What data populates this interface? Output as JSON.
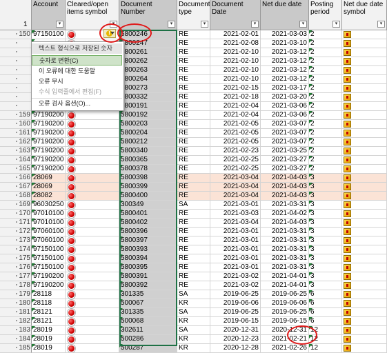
{
  "header": {
    "row_number": "1",
    "columns": [
      {
        "key": "account",
        "label": "Account"
      },
      {
        "key": "cleared",
        "label": "Cleared/open items symbol"
      },
      {
        "key": "docnum",
        "label": "Document Number"
      },
      {
        "key": "doctype",
        "label": "Document type"
      },
      {
        "key": "docdate",
        "label": "Document Date"
      },
      {
        "key": "netdue",
        "label": "Net due date"
      },
      {
        "key": "period",
        "label": "Posting period"
      },
      {
        "key": "netsym",
        "label": "Net due date symbol"
      }
    ],
    "filter_glyph": "▾"
  },
  "context_menu": {
    "items": [
      {
        "label": "텍스트 형식으로 저장된 숫자",
        "state": "title"
      },
      {
        "label": "숫자로 변환(C)",
        "state": "active"
      },
      {
        "label": "이 오류에 대한 도움말",
        "state": "normal"
      },
      {
        "label": "오류 무시",
        "state": "normal"
      },
      {
        "label": "수식 입력줄에서 편집(F)",
        "state": "disabled"
      },
      {
        "label": "오류 검사 옵션(O)...",
        "state": "normal"
      }
    ]
  },
  "warning_button": {
    "glyph": "!"
  },
  "rows": [
    {
      "n": "150",
      "account": "97150100",
      "doc": "5800246",
      "type": "RE",
      "date": "2021-02-01",
      "due": "2021-03-03",
      "period": "2",
      "hl": false
    },
    {
      "n": "",
      "account": "",
      "doc": "5800247",
      "type": "RE",
      "date": "2021-02-08",
      "due": "2021-03-10",
      "period": "2",
      "hl": false
    },
    {
      "n": "",
      "account": "",
      "doc": "5800261",
      "type": "RE",
      "date": "2021-02-10",
      "due": "2021-03-12",
      "period": "2",
      "hl": false
    },
    {
      "n": "",
      "account": "",
      "doc": "5800262",
      "type": "RE",
      "date": "2021-02-10",
      "due": "2021-03-12",
      "period": "2",
      "hl": false
    },
    {
      "n": "",
      "account": "",
      "doc": "5800263",
      "type": "RE",
      "date": "2021-02-10",
      "due": "2021-03-12",
      "period": "2",
      "hl": false
    },
    {
      "n": "",
      "account": "",
      "doc": "5800264",
      "type": "RE",
      "date": "2021-02-10",
      "due": "2021-03-12",
      "period": "2",
      "hl": false
    },
    {
      "n": "",
      "account": "",
      "doc": "5800273",
      "type": "RE",
      "date": "2021-02-15",
      "due": "2021-03-17",
      "period": "2",
      "hl": false
    },
    {
      "n": "",
      "account": "",
      "doc": "5800332",
      "type": "RE",
      "date": "2021-02-18",
      "due": "2021-03-20",
      "period": "2",
      "hl": false
    },
    {
      "n": "",
      "account": "",
      "doc": "5800191",
      "type": "RE",
      "date": "2021-02-04",
      "due": "2021-03-06",
      "period": "2",
      "hl": false
    },
    {
      "n": "159",
      "account": "97190200",
      "doc": "5800192",
      "type": "RE",
      "date": "2021-02-04",
      "due": "2021-03-06",
      "period": "2",
      "hl": false
    },
    {
      "n": "160",
      "account": "97190200",
      "doc": "5800203",
      "type": "RE",
      "date": "2021-02-05",
      "due": "2021-03-07",
      "period": "2",
      "hl": false
    },
    {
      "n": "161",
      "account": "97190200",
      "doc": "5800204",
      "type": "RE",
      "date": "2021-02-05",
      "due": "2021-03-07",
      "period": "2",
      "hl": false
    },
    {
      "n": "162",
      "account": "97190200",
      "doc": "5800212",
      "type": "RE",
      "date": "2021-02-05",
      "due": "2021-03-07",
      "period": "2",
      "hl": false
    },
    {
      "n": "163",
      "account": "97190200",
      "doc": "5800340",
      "type": "RE",
      "date": "2021-02-23",
      "due": "2021-03-25",
      "period": "2",
      "hl": false
    },
    {
      "n": "164",
      "account": "97190200",
      "doc": "5800365",
      "type": "RE",
      "date": "2021-02-25",
      "due": "2021-03-27",
      "period": "2",
      "hl": false
    },
    {
      "n": "165",
      "account": "97190200",
      "doc": "5800378",
      "type": "RE",
      "date": "2021-02-25",
      "due": "2021-03-27",
      "period": "2",
      "hl": false
    },
    {
      "n": "166",
      "account": "28069",
      "doc": "5800398",
      "type": "RE",
      "date": "2021-03-04",
      "due": "2021-04-03",
      "period": "3",
      "hl": true
    },
    {
      "n": "167",
      "account": "28069",
      "doc": "5800399",
      "type": "RE",
      "date": "2021-03-04",
      "due": "2021-04-03",
      "period": "3",
      "hl": true
    },
    {
      "n": "168",
      "account": "28082",
      "doc": "5800400",
      "type": "RE",
      "date": "2021-03-04",
      "due": "2021-04-03",
      "period": "3",
      "hl": true
    },
    {
      "n": "169",
      "account": "96030250",
      "doc": "300349",
      "type": "SA",
      "date": "2021-03-01",
      "due": "2021-03-31",
      "period": "3",
      "hl": false
    },
    {
      "n": "170",
      "account": "97010100",
      "doc": "5800401",
      "type": "RE",
      "date": "2021-03-03",
      "due": "2021-04-02",
      "period": "3",
      "hl": false
    },
    {
      "n": "171",
      "account": "97010100",
      "doc": "5800402",
      "type": "RE",
      "date": "2021-03-04",
      "due": "2021-04-03",
      "period": "3",
      "hl": false
    },
    {
      "n": "172",
      "account": "97060100",
      "doc": "5800396",
      "type": "RE",
      "date": "2021-03-01",
      "due": "2021-03-31",
      "period": "3",
      "hl": false
    },
    {
      "n": "173",
      "account": "97060100",
      "doc": "5800397",
      "type": "RE",
      "date": "2021-03-01",
      "due": "2021-03-31",
      "period": "3",
      "hl": false
    },
    {
      "n": "174",
      "account": "97150100",
      "doc": "5800393",
      "type": "RE",
      "date": "2021-03-01",
      "due": "2021-03-31",
      "period": "3",
      "hl": false
    },
    {
      "n": "175",
      "account": "97150100",
      "doc": "5800394",
      "type": "RE",
      "date": "2021-03-01",
      "due": "2021-03-31",
      "period": "3",
      "hl": false
    },
    {
      "n": "176",
      "account": "97150100",
      "doc": "5800395",
      "type": "RE",
      "date": "2021-03-01",
      "due": "2021-03-31",
      "period": "3",
      "hl": false
    },
    {
      "n": "177",
      "account": "97190200",
      "doc": "5800391",
      "type": "RE",
      "date": "2021-03-02",
      "due": "2021-04-01",
      "period": "3",
      "hl": false
    },
    {
      "n": "178",
      "account": "97190200",
      "doc": "5800392",
      "type": "RE",
      "date": "2021-03-02",
      "due": "2021-04-01",
      "period": "3",
      "hl": false
    },
    {
      "n": "179",
      "account": "28118",
      "doc": "301335",
      "type": "SA",
      "date": "2019-06-25",
      "due": "2019-06-25",
      "period": "6",
      "hl": false
    },
    {
      "n": "180",
      "account": "28118",
      "doc": "500067",
      "type": "KR",
      "date": "2019-06-06",
      "due": "2019-06-06",
      "period": "6",
      "hl": false
    },
    {
      "n": "181",
      "account": "28121",
      "doc": "301335",
      "type": "SA",
      "date": "2019-06-25",
      "due": "2019-06-25",
      "period": "6",
      "hl": false
    },
    {
      "n": "182",
      "account": "28121",
      "doc": "500068",
      "type": "KR",
      "date": "2019-06-15",
      "due": "2019-06-15",
      "period": "6",
      "hl": false
    },
    {
      "n": "183",
      "account": "28019",
      "doc": "302611",
      "type": "SA",
      "date": "2020-12-31",
      "due": "2020-12-31",
      "period": "12",
      "hl": false
    },
    {
      "n": "184",
      "account": "28019",
      "doc": "500286",
      "type": "KR",
      "date": "2020-12-23",
      "due": "2021-02-21",
      "period": "12",
      "hl": false
    },
    {
      "n": "185",
      "account": "28019",
      "doc": "500287",
      "type": "KR",
      "date": "2020-12-28",
      "due": "2021-02-26",
      "period": "12",
      "hl": false
    }
  ]
}
